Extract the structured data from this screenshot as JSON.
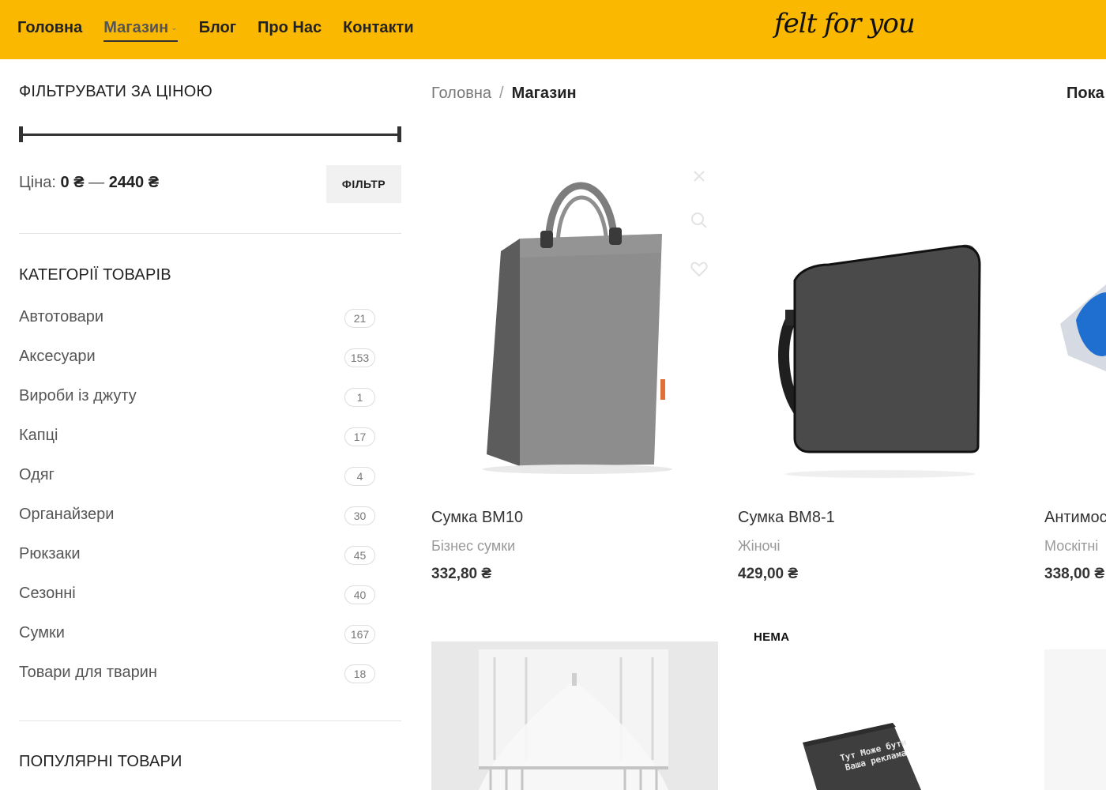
{
  "header": {
    "nav": [
      {
        "label": "Головна"
      },
      {
        "label": "Магазин",
        "active": true,
        "has_dropdown": true
      },
      {
        "label": "Блог"
      },
      {
        "label": "Про Нас"
      },
      {
        "label": "Контакти"
      }
    ],
    "logo_text": "felt for you",
    "background_color": "#fbb800"
  },
  "sidebar": {
    "price_filter": {
      "title": "ФІЛЬТРУВАТИ ЗА ЦІНОЮ",
      "label": "Ціна:",
      "min": "0 ₴",
      "max": "2440 ₴",
      "dash": "—",
      "button": "ФІЛЬТР",
      "range_min_fraction": 0.0,
      "range_max_fraction": 1.0
    },
    "categories": {
      "title": "КАТЕГОРІЇ ТОВАРІВ",
      "items": [
        {
          "name": "Автотовари",
          "count": "21"
        },
        {
          "name": "Аксесуари",
          "count": "153"
        },
        {
          "name": "Вироби із джуту",
          "count": "1"
        },
        {
          "name": "Капці",
          "count": "17"
        },
        {
          "name": "Одяг",
          "count": "4"
        },
        {
          "name": "Органайзери",
          "count": "30"
        },
        {
          "name": "Рюкзаки",
          "count": "45"
        },
        {
          "name": "Сезонні",
          "count": "40"
        },
        {
          "name": "Сумки",
          "count": "167"
        },
        {
          "name": "Товари для тварин",
          "count": "18"
        }
      ]
    },
    "popular": {
      "title": "ПОПУЛЯРНІ ТОВАРИ"
    }
  },
  "main": {
    "breadcrumb": {
      "home": "Головна",
      "sep": "/",
      "current": "Магазин"
    },
    "show_label": "Пока",
    "products": [
      {
        "title": "Сумка ВМ10",
        "category": "Бізнес сумки",
        "price": "332,80 ₴"
      },
      {
        "title": "Сумка ВМ8-1",
        "category": "Жіночі",
        "price": "429,00 ₴"
      },
      {
        "title": "Антимос",
        "category": "Москітні",
        "price": "338,00 ₴"
      },
      {
        "badge": ""
      },
      {
        "badge": "НЕМА",
        "print_text": "Тут Може бути Ваша реклама"
      }
    ]
  }
}
